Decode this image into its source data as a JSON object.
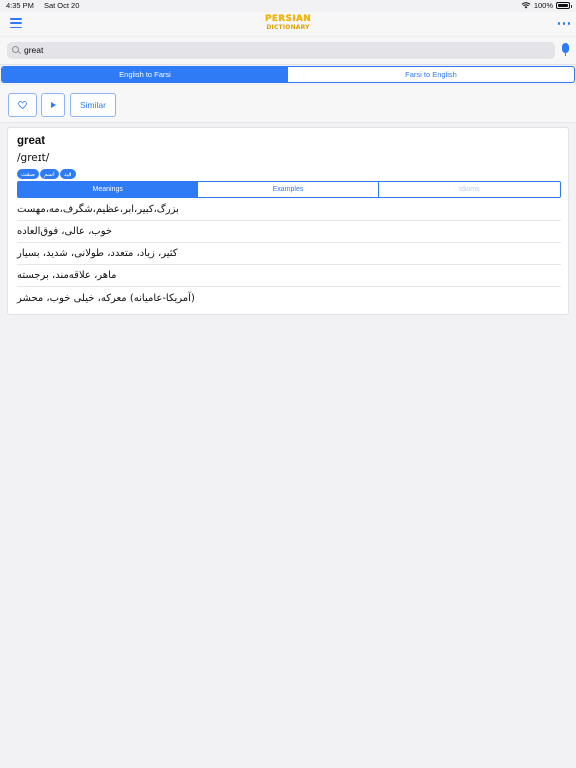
{
  "status": {
    "time": "4:35 PM",
    "date": "Sat Oct 20",
    "battery": "100%"
  },
  "navbar": {
    "logo_line1": "PERSIAN",
    "logo_line2": "DICTIONARY",
    "menu_icon": "hamburger-icon",
    "more_icon": "more-icon"
  },
  "search": {
    "value": "great",
    "search_icon": "search-icon",
    "mic_icon": "microphone-icon"
  },
  "direction_tabs": [
    {
      "label": "English to Farsi",
      "active": true
    },
    {
      "label": "Farsi to English",
      "active": false
    }
  ],
  "toolbar": {
    "favorite_icon": "heart-icon",
    "play_icon": "play-icon",
    "similar_label": "Similar"
  },
  "entry": {
    "word": "great",
    "pronunciation": "/greɪt/",
    "tags": [
      "صفت",
      "اسم",
      "قید"
    ],
    "tabs": [
      {
        "label": "Meanings",
        "active": true
      },
      {
        "label": "Examples",
        "active": false
      },
      {
        "label": "Idioms",
        "active": false,
        "disabled": true
      }
    ],
    "meanings": [
      "بزرگ،کبیر،ابر،عظیم،شگرف،مه،مهست",
      "خوب، عالی، فوق‌العاده",
      "کثیر، زیاد، متعدد، طولانی، شدید، بسیار",
      "ماهر، علاقه‌مند، برجسته",
      "(آمریکا-عامیانه) معرکه، خیلی خوب، محشر"
    ]
  },
  "colors": {
    "accent": "#2f7bf5",
    "logo": "#f2b705"
  }
}
